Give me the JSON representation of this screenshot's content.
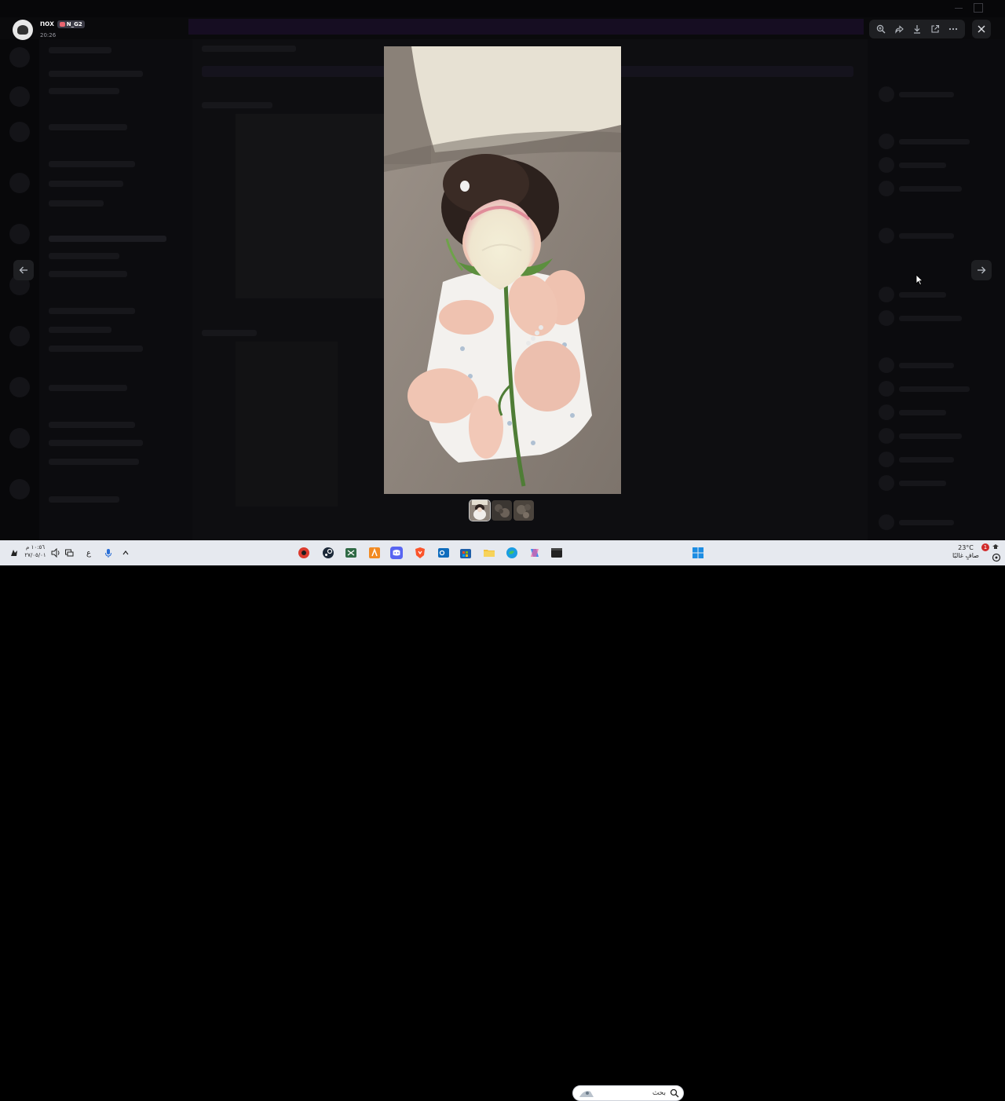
{
  "viewer": {
    "username": "nox",
    "tag": "N_G2",
    "timestamp": "20:26",
    "toolbar": {
      "zoom_icon": "zoom-in-icon",
      "forward_icon": "forward-icon",
      "download_icon": "download-icon",
      "open_external_icon": "open-external-icon",
      "more_icon": "more-icon"
    },
    "close_icon": "close-icon",
    "prev_icon": "arrow-left-icon",
    "next_icon": "arrow-right-icon",
    "thumbnails": 3,
    "active_thumbnail": 1
  },
  "taskbar": {
    "clock_time": "١٠:٥٦ م",
    "clock_date": "٢٧/٠٥/٠١",
    "language": "ع",
    "search_placeholder": "بحث",
    "weather_temp": "23°C",
    "weather_desc": "صافٍ غالبًا",
    "notification_count": "1",
    "colors": {
      "taskbar_bg": "#e6e9ef"
    }
  }
}
